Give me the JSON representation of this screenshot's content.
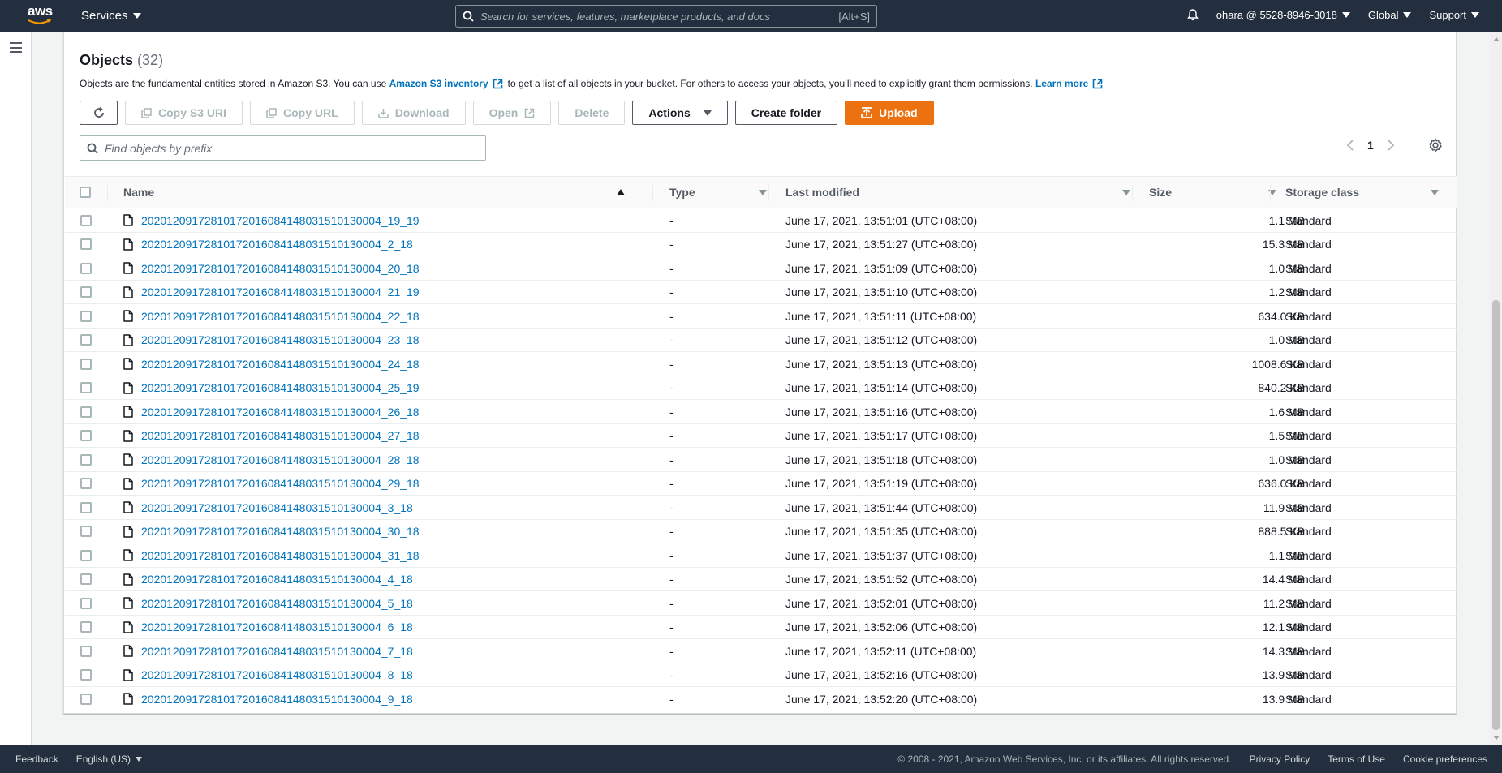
{
  "nav": {
    "logo_text": "aws",
    "services_label": "Services",
    "search_placeholder": "Search for services, features, marketplace products, and docs",
    "search_shortcut": "[Alt+S]",
    "account_label": "ohara @ 5528-8946-3018",
    "region_label": "Global",
    "support_label": "Support"
  },
  "objects": {
    "title": "Objects",
    "count": "(32)",
    "desc_before": "Objects are the fundamental entities stored in Amazon S3. You can use",
    "inventory_link": "Amazon S3 inventory",
    "desc_middle": "to get a list of all objects in your bucket. For others to access your objects, you’ll need to explicitly grant them permissions.",
    "learn_more": "Learn more"
  },
  "toolbar": {
    "copy_s3_uri": "Copy S3 URI",
    "copy_url": "Copy URL",
    "download": "Download",
    "open": "Open",
    "delete": "Delete",
    "actions": "Actions",
    "create_folder": "Create folder",
    "upload": "Upload"
  },
  "filter": {
    "placeholder": "Find objects by prefix"
  },
  "pager": {
    "page": "1"
  },
  "table": {
    "columns": {
      "name": "Name",
      "type": "Type",
      "last_modified": "Last modified",
      "size": "Size",
      "storage_class": "Storage class"
    },
    "rows": [
      {
        "name": "20201209172810172016084148031510130004_19_19",
        "type": "-",
        "modified": "June 17, 2021, 13:51:01 (UTC+08:00)",
        "size": "1.1 MB",
        "class": "Standard"
      },
      {
        "name": "20201209172810172016084148031510130004_2_18",
        "type": "-",
        "modified": "June 17, 2021, 13:51:27 (UTC+08:00)",
        "size": "15.3 MB",
        "class": "Standard"
      },
      {
        "name": "20201209172810172016084148031510130004_20_18",
        "type": "-",
        "modified": "June 17, 2021, 13:51:09 (UTC+08:00)",
        "size": "1.0 MB",
        "class": "Standard"
      },
      {
        "name": "20201209172810172016084148031510130004_21_19",
        "type": "-",
        "modified": "June 17, 2021, 13:51:10 (UTC+08:00)",
        "size": "1.2 MB",
        "class": "Standard"
      },
      {
        "name": "20201209172810172016084148031510130004_22_18",
        "type": "-",
        "modified": "June 17, 2021, 13:51:11 (UTC+08:00)",
        "size": "634.0 KB",
        "class": "Standard"
      },
      {
        "name": "20201209172810172016084148031510130004_23_18",
        "type": "-",
        "modified": "June 17, 2021, 13:51:12 (UTC+08:00)",
        "size": "1.0 MB",
        "class": "Standard"
      },
      {
        "name": "20201209172810172016084148031510130004_24_18",
        "type": "-",
        "modified": "June 17, 2021, 13:51:13 (UTC+08:00)",
        "size": "1008.6 KB",
        "class": "Standard"
      },
      {
        "name": "20201209172810172016084148031510130004_25_19",
        "type": "-",
        "modified": "June 17, 2021, 13:51:14 (UTC+08:00)",
        "size": "840.2 KB",
        "class": "Standard"
      },
      {
        "name": "20201209172810172016084148031510130004_26_18",
        "type": "-",
        "modified": "June 17, 2021, 13:51:16 (UTC+08:00)",
        "size": "1.6 MB",
        "class": "Standard"
      },
      {
        "name": "20201209172810172016084148031510130004_27_18",
        "type": "-",
        "modified": "June 17, 2021, 13:51:17 (UTC+08:00)",
        "size": "1.5 MB",
        "class": "Standard"
      },
      {
        "name": "20201209172810172016084148031510130004_28_18",
        "type": "-",
        "modified": "June 17, 2021, 13:51:18 (UTC+08:00)",
        "size": "1.0 MB",
        "class": "Standard"
      },
      {
        "name": "20201209172810172016084148031510130004_29_18",
        "type": "-",
        "modified": "June 17, 2021, 13:51:19 (UTC+08:00)",
        "size": "636.0 KB",
        "class": "Standard"
      },
      {
        "name": "20201209172810172016084148031510130004_3_18",
        "type": "-",
        "modified": "June 17, 2021, 13:51:44 (UTC+08:00)",
        "size": "11.9 MB",
        "class": "Standard"
      },
      {
        "name": "20201209172810172016084148031510130004_30_18",
        "type": "-",
        "modified": "June 17, 2021, 13:51:35 (UTC+08:00)",
        "size": "888.5 KB",
        "class": "Standard"
      },
      {
        "name": "20201209172810172016084148031510130004_31_18",
        "type": "-",
        "modified": "June 17, 2021, 13:51:37 (UTC+08:00)",
        "size": "1.1 MB",
        "class": "Standard"
      },
      {
        "name": "20201209172810172016084148031510130004_4_18",
        "type": "-",
        "modified": "June 17, 2021, 13:51:52 (UTC+08:00)",
        "size": "14.4 MB",
        "class": "Standard"
      },
      {
        "name": "20201209172810172016084148031510130004_5_18",
        "type": "-",
        "modified": "June 17, 2021, 13:52:01 (UTC+08:00)",
        "size": "11.2 MB",
        "class": "Standard"
      },
      {
        "name": "20201209172810172016084148031510130004_6_18",
        "type": "-",
        "modified": "June 17, 2021, 13:52:06 (UTC+08:00)",
        "size": "12.1 MB",
        "class": "Standard"
      },
      {
        "name": "20201209172810172016084148031510130004_7_18",
        "type": "-",
        "modified": "June 17, 2021, 13:52:11 (UTC+08:00)",
        "size": "14.3 MB",
        "class": "Standard"
      },
      {
        "name": "20201209172810172016084148031510130004_8_18",
        "type": "-",
        "modified": "June 17, 2021, 13:52:16 (UTC+08:00)",
        "size": "13.9 MB",
        "class": "Standard"
      },
      {
        "name": "20201209172810172016084148031510130004_9_18",
        "type": "-",
        "modified": "June 17, 2021, 13:52:20 (UTC+08:00)",
        "size": "13.9 MB",
        "class": "Standard"
      }
    ]
  },
  "footer": {
    "feedback": "Feedback",
    "language": "English (US)",
    "copyright": "© 2008 - 2021, Amazon Web Services, Inc. or its affiliates. All rights reserved.",
    "privacy": "Privacy Policy",
    "terms": "Terms of Use",
    "cookies": "Cookie preferences"
  },
  "colors": {
    "nav_bg": "#232f3e",
    "link": "#0073bb",
    "primary": "#ec7211"
  }
}
